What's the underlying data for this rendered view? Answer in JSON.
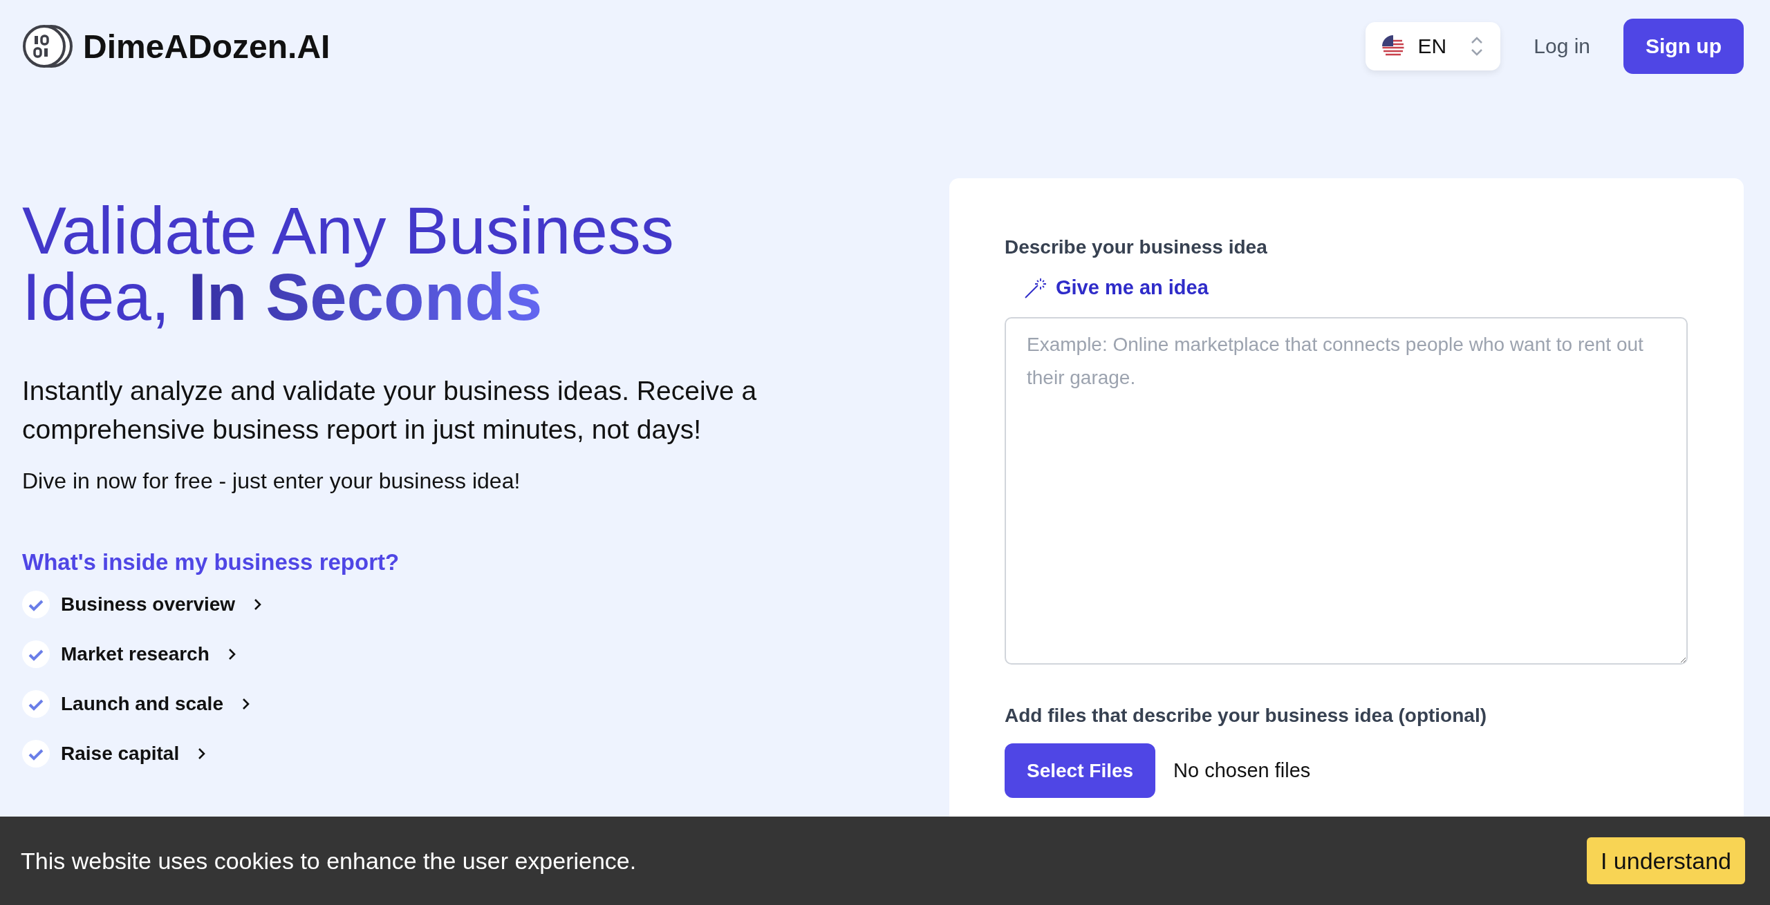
{
  "header": {
    "logo_text": "DimeADozen.AI",
    "language": {
      "code": "EN"
    },
    "login": "Log in",
    "signup": "Sign up"
  },
  "hero": {
    "title": "Validate Any Business Idea, **In Seconds**",
    "lead": "Instantly analyze and validate your business ideas. Receive a comprehensive business report in just minutes, not days!",
    "sub": "Dive in now for free - just enter your business idea!",
    "inside_heading": "What's inside my business report?",
    "features": [
      {
        "label": "Business overview"
      },
      {
        "label": "Market research"
      },
      {
        "label": "Launch and scale"
      },
      {
        "label": "Raise capital"
      }
    ]
  },
  "form": {
    "idea_label": "Describe your business idea",
    "idea_button": "Give me an idea",
    "idea_placeholder": "Example: Online marketplace that connects people who want to rent out their garage.",
    "files_label": "Add files that describe your business idea (optional)",
    "files_button": "Select Files",
    "files_status": "No chosen files"
  },
  "cookie_bar": {
    "message": "This website uses cookies to enhance the user experience.",
    "button": "I understand"
  }
}
